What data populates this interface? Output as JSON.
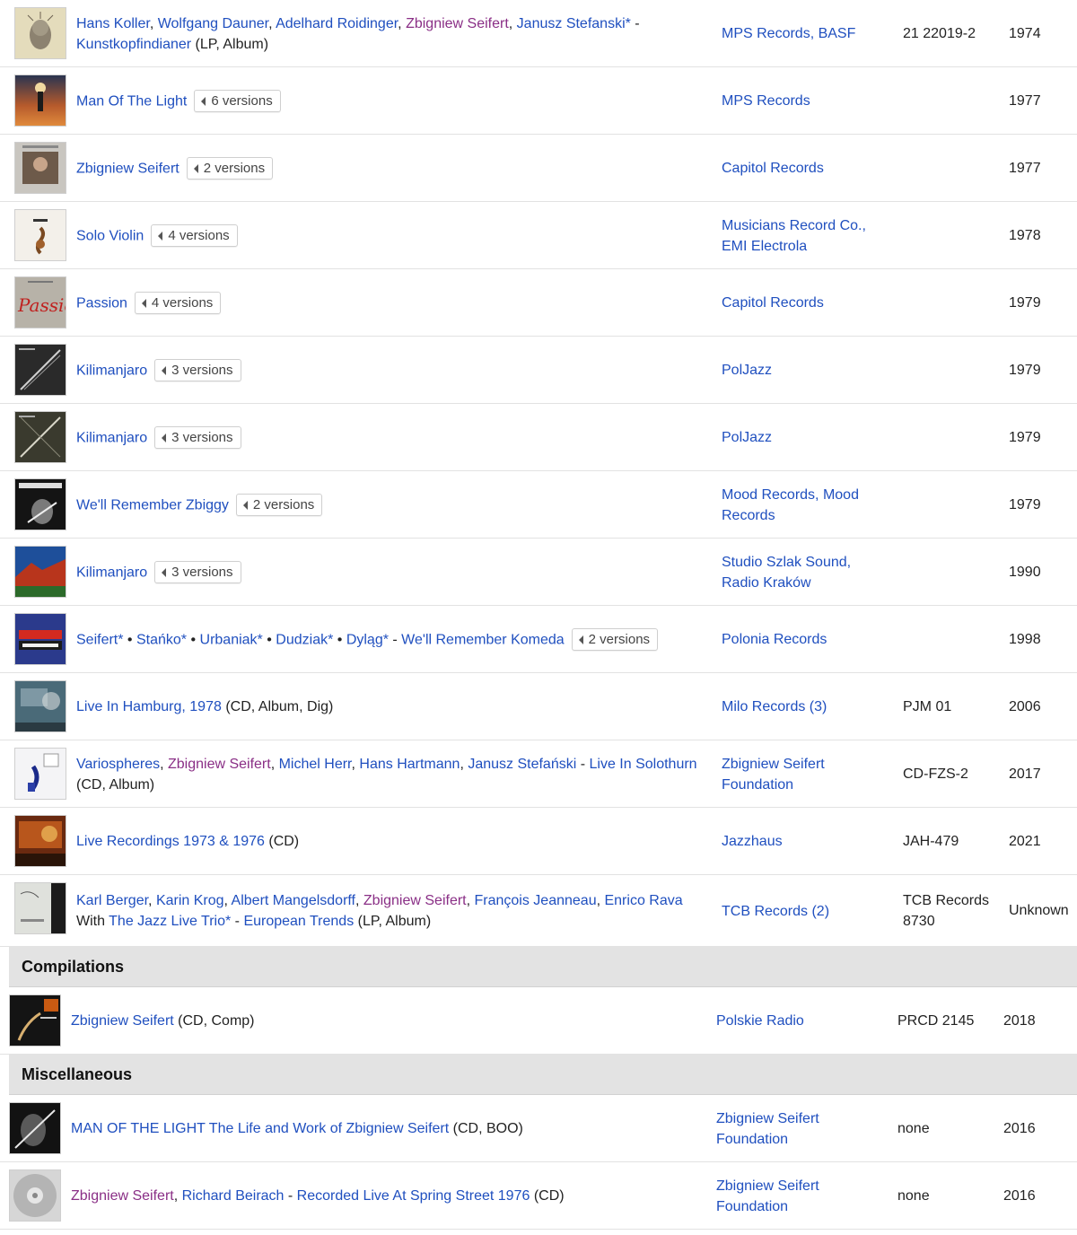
{
  "releases": [
    {
      "title_parts": [
        {
          "t": "Hans Koller",
          "c": "lnk"
        },
        {
          "t": ", ",
          "c": "plain"
        },
        {
          "t": "Wolfgang Dauner",
          "c": "lnk"
        },
        {
          "t": ", ",
          "c": "plain"
        },
        {
          "t": "Adelhard Roidinger",
          "c": "lnk"
        },
        {
          "t": ", ",
          "c": "plain"
        },
        {
          "t": "Zbigniew Seifert",
          "c": "pur"
        },
        {
          "t": ", ",
          "c": "plain"
        },
        {
          "t": "Janusz Stefanski*",
          "c": "lnk"
        },
        {
          "t": " - ",
          "c": "plain"
        },
        {
          "t": "Kunstkopfindianer",
          "c": "lnk"
        },
        {
          "t": " (LP, Album)",
          "c": "plain"
        }
      ],
      "versions": "",
      "label": "MPS Records, BASF",
      "catno": "21 22019-2",
      "year": "1974"
    },
    {
      "title_parts": [
        {
          "t": "Man Of The Light",
          "c": "lnk"
        }
      ],
      "versions": "6 versions",
      "label": "MPS Records",
      "catno": "",
      "year": "1977"
    },
    {
      "title_parts": [
        {
          "t": "Zbigniew Seifert",
          "c": "lnk"
        }
      ],
      "versions": "2 versions",
      "label": "Capitol Records",
      "catno": "",
      "year": "1977"
    },
    {
      "title_parts": [
        {
          "t": "Solo Violin",
          "c": "lnk"
        }
      ],
      "versions": "4 versions",
      "label": "Musicians Record Co., EMI Electrola",
      "catno": "",
      "year": "1978"
    },
    {
      "title_parts": [
        {
          "t": "Passion",
          "c": "lnk"
        }
      ],
      "versions": "4 versions",
      "label": "Capitol Records",
      "catno": "",
      "year": "1979"
    },
    {
      "title_parts": [
        {
          "t": "Kilimanjaro",
          "c": "lnk"
        }
      ],
      "versions": "3 versions",
      "label": "PolJazz",
      "catno": "",
      "year": "1979"
    },
    {
      "title_parts": [
        {
          "t": "Kilimanjaro",
          "c": "lnk"
        }
      ],
      "versions": "3 versions",
      "label": "PolJazz",
      "catno": "",
      "year": "1979"
    },
    {
      "title_parts": [
        {
          "t": "We'll Remember Zbiggy",
          "c": "lnk"
        }
      ],
      "versions": "2 versions",
      "label": "Mood Records, Mood Records",
      "catno": "",
      "year": "1979"
    },
    {
      "title_parts": [
        {
          "t": "Kilimanjaro",
          "c": "lnk"
        }
      ],
      "versions": "3 versions",
      "label": "Studio Szlak Sound, Radio Kraków",
      "catno": "",
      "year": "1990"
    },
    {
      "title_parts": [
        {
          "t": "Seifert*",
          "c": "lnk"
        },
        {
          "t": " • ",
          "c": "plain"
        },
        {
          "t": "Stańko*",
          "c": "lnk"
        },
        {
          "t": " • ",
          "c": "plain"
        },
        {
          "t": "Urbaniak*",
          "c": "lnk"
        },
        {
          "t": " • ",
          "c": "plain"
        },
        {
          "t": "Dudziak*",
          "c": "lnk"
        },
        {
          "t": " • ",
          "c": "plain"
        },
        {
          "t": "Dyląg*",
          "c": "lnk"
        },
        {
          "t": " - ",
          "c": "plain"
        },
        {
          "t": "We'll Remember Komeda",
          "c": "lnk"
        }
      ],
      "versions": "2 versions",
      "label": "Polonia Records",
      "catno": "",
      "year": "1998"
    },
    {
      "title_parts": [
        {
          "t": "Live In Hamburg, 1978",
          "c": "lnk"
        },
        {
          "t": " (CD, Album, Dig)",
          "c": "plain"
        }
      ],
      "versions": "",
      "label": "Milo Records (3)",
      "catno": "PJM 01",
      "year": "2006"
    },
    {
      "title_parts": [
        {
          "t": "Variospheres",
          "c": "lnk"
        },
        {
          "t": ", ",
          "c": "plain"
        },
        {
          "t": "Zbigniew Seifert",
          "c": "pur"
        },
        {
          "t": ", ",
          "c": "plain"
        },
        {
          "t": "Michel Herr",
          "c": "lnk"
        },
        {
          "t": ", ",
          "c": "plain"
        },
        {
          "t": "Hans Hartmann",
          "c": "lnk"
        },
        {
          "t": ", ",
          "c": "plain"
        },
        {
          "t": "Janusz Stefański",
          "c": "lnk"
        },
        {
          "t": " - ",
          "c": "plain"
        },
        {
          "t": "Live In Solothurn",
          "c": "lnk"
        },
        {
          "t": " (CD, Album)",
          "c": "plain"
        }
      ],
      "versions": "",
      "label": "Zbigniew Seifert Foundation",
      "catno": "CD-FZS-2",
      "year": "2017"
    },
    {
      "title_parts": [
        {
          "t": "Live Recordings 1973 & 1976",
          "c": "lnk"
        },
        {
          "t": " (CD)",
          "c": "plain"
        }
      ],
      "versions": "",
      "label": "Jazzhaus",
      "catno": "JAH-479",
      "year": "2021"
    },
    {
      "title_parts": [
        {
          "t": "Karl Berger",
          "c": "lnk"
        },
        {
          "t": ", ",
          "c": "plain"
        },
        {
          "t": "Karin Krog",
          "c": "lnk"
        },
        {
          "t": ", ",
          "c": "plain"
        },
        {
          "t": "Albert Mangelsdorff",
          "c": "lnk"
        },
        {
          "t": ", ",
          "c": "plain"
        },
        {
          "t": "Zbigniew Seifert",
          "c": "pur"
        },
        {
          "t": ", ",
          "c": "plain"
        },
        {
          "t": "François Jeanneau",
          "c": "lnk"
        },
        {
          "t": ", ",
          "c": "plain"
        },
        {
          "t": "Enrico Rava",
          "c": "lnk"
        },
        {
          "t": " With ",
          "c": "plain"
        },
        {
          "t": "The Jazz Live Trio*",
          "c": "lnk"
        },
        {
          "t": " - ",
          "c": "plain"
        },
        {
          "t": "European Trends",
          "c": "lnk"
        },
        {
          "t": " (LP, Album)",
          "c": "plain"
        }
      ],
      "versions": "",
      "label": "TCB Records (2)",
      "catno": "TCB Records 8730",
      "year": "Unknown"
    }
  ],
  "sections": [
    {
      "heading": "Compilations",
      "rows": [
        {
          "title_parts": [
            {
              "t": "Zbigniew Seifert",
              "c": "lnk"
            },
            {
              "t": " (CD, Comp)",
              "c": "plain"
            }
          ],
          "label": "Polskie Radio",
          "catno": "PRCD 2145",
          "year": "2018"
        }
      ]
    },
    {
      "heading": "Miscellaneous",
      "rows": [
        {
          "title_parts": [
            {
              "t": "MAN OF THE LIGHT The Life and Work of Zbigniew Seifert",
              "c": "lnk"
            },
            {
              "t": " (CD, BOO)",
              "c": "plain"
            }
          ],
          "label": "Zbigniew Seifert Foundation",
          "catno": "none",
          "year": "2016"
        },
        {
          "title_parts": [
            {
              "t": "Zbigniew Seifert",
              "c": "pur"
            },
            {
              "t": ", ",
              "c": "plain"
            },
            {
              "t": "Richard Beirach",
              "c": "lnk"
            },
            {
              "t": " - ",
              "c": "plain"
            },
            {
              "t": "Recorded Live At Spring Street 1976",
              "c": "lnk"
            },
            {
              "t": " (CD)",
              "c": "plain"
            }
          ],
          "label": "Zbigniew Seifert Foundation",
          "catno": "none",
          "year": "2016"
        }
      ]
    }
  ],
  "icons": {
    "versions_toggle": "caret-left-icon"
  },
  "colors": {
    "link": "#1f4fbf",
    "artist_highlight": "#8a2f86",
    "section_bg": "#e3e3e3"
  }
}
